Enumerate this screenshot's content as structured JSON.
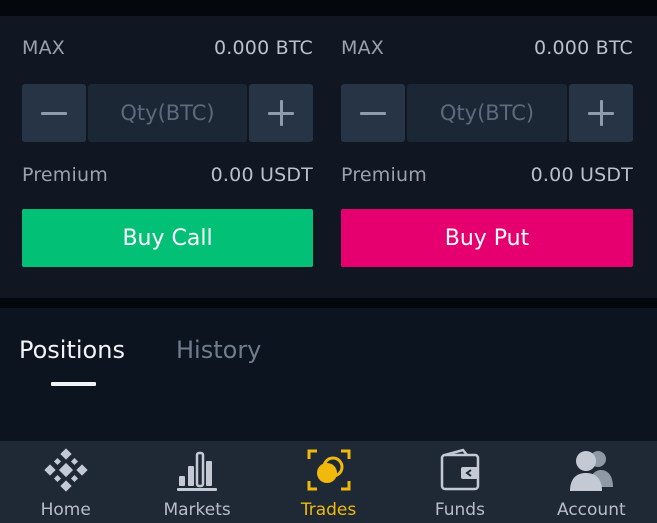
{
  "call": {
    "max_label": "MAX",
    "max_value": "0.000 BTC",
    "qty_placeholder": "Qty(BTC)",
    "premium_label": "Premium",
    "premium_value": "0.00 USDT",
    "button_label": "Buy Call",
    "button_color": "#02c076"
  },
  "put": {
    "max_label": "MAX",
    "max_value": "0.000 BTC",
    "qty_placeholder": "Qty(BTC)",
    "premium_label": "Premium",
    "premium_value": "0.00 USDT",
    "button_label": "Buy Put",
    "button_color": "#e6006f"
  },
  "tabs": [
    {
      "label": "Positions",
      "active": true
    },
    {
      "label": "History",
      "active": false
    }
  ],
  "nav": {
    "items": [
      {
        "label": "Home",
        "icon": "home-icon"
      },
      {
        "label": "Markets",
        "icon": "markets-icon"
      },
      {
        "label": "Trades",
        "icon": "trades-icon",
        "active": true
      },
      {
        "label": "Funds",
        "icon": "funds-icon"
      },
      {
        "label": "Account",
        "icon": "account-icon"
      }
    ],
    "active_color": "#f0b90b"
  }
}
